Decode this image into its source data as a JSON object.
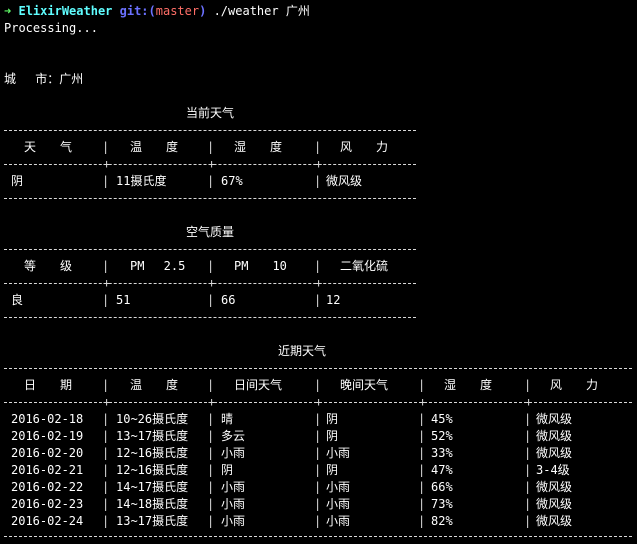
{
  "prompt": {
    "arrow": "➜",
    "dir": "ElixirWeather",
    "git_prefix": "git:(",
    "branch": "master",
    "git_suffix": ")",
    "command": " ./weather 广州"
  },
  "processing": "Processing...",
  "city": "城　 市：广州",
  "current": {
    "title": "当前天气",
    "headers": [
      "天　　气",
      "温　　度",
      "湿　　度",
      "风　　力"
    ],
    "row": [
      "阴",
      "11摄氏度",
      "67%",
      "微风级"
    ]
  },
  "air": {
    "title": "空气质量",
    "headers": [
      "等　　级",
      "PM　 2.5",
      "PM　　10",
      "二氧化硫"
    ],
    "row": [
      "良",
      "51",
      "66",
      "12"
    ]
  },
  "forecast": {
    "title": "近期天气",
    "headers": [
      "日　　期",
      "温　　度",
      "日间天气",
      "晚间天气",
      "湿　　度",
      "风　　力"
    ],
    "rows": [
      [
        "2016-02-18",
        "10~26摄氏度",
        "晴",
        "阴",
        "45%",
        "微风级"
      ],
      [
        "2016-02-19",
        "13~17摄氏度",
        "多云",
        "阴",
        "52%",
        "微风级"
      ],
      [
        "2016-02-20",
        "12~16摄氏度",
        "小雨",
        "小雨",
        "33%",
        "微风级"
      ],
      [
        "2016-02-21",
        "12~16摄氏度",
        "阴",
        "阴",
        "47%",
        "3-4级"
      ],
      [
        "2016-02-22",
        "14~17摄氏度",
        "小雨",
        "小雨",
        "66%",
        "微风级"
      ],
      [
        "2016-02-23",
        "14~18摄氏度",
        "小雨",
        "小雨",
        "73%",
        "微风级"
      ],
      [
        "2016-02-24",
        "13~17摄氏度",
        "小雨",
        "小雨",
        "82%",
        "微风级"
      ]
    ]
  }
}
